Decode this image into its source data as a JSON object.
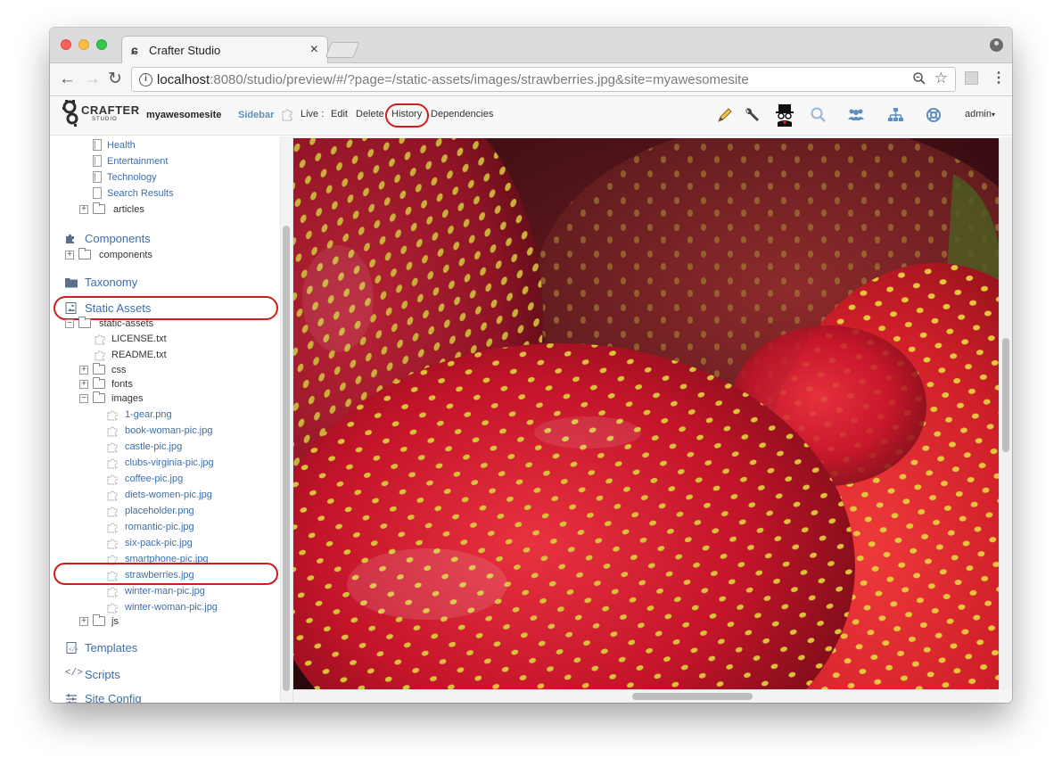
{
  "browser": {
    "tab_title": "Crafter Studio",
    "tab_close": "×",
    "url_host": "localhost",
    "url_rest": ":8080/studio/preview/#/?page=/static-assets/images/strawberries.jpg&site=myawesomesite"
  },
  "header": {
    "logo_text": "CRAFTER",
    "logo_sub": "STUDIO",
    "site_name": "myawesomesite",
    "sidebar_label": "Sidebar",
    "live_label": "Live :",
    "actions": [
      "Edit",
      "Delete",
      "History",
      "Dependencies"
    ],
    "user": "admin",
    "icons": [
      "pencil-icon",
      "wrench-icon",
      "incognito-preview-icon",
      "search-icon",
      "users-icon",
      "sitemap-icon",
      "help-icon"
    ]
  },
  "sidebar": {
    "pages": [
      "Health",
      "Entertainment",
      "Technology",
      "Search Results"
    ],
    "articles_folder": "articles",
    "components_section": "Components",
    "components_folder": "components",
    "taxonomy_section": "Taxonomy",
    "static_assets_section": "Static Assets",
    "static_assets_root": "static-assets",
    "root_files": [
      "LICENSE.txt",
      "README.txt"
    ],
    "root_folders": [
      "css",
      "fonts",
      "images"
    ],
    "images": [
      "1-gear.png",
      "book-woman-pic.jpg",
      "castle-pic.jpg",
      "clubs-virginia-pic.jpg",
      "coffee-pic.jpg",
      "diets-women-pic.jpg",
      "placeholder.png",
      "romantic-pic.jpg",
      "six-pack-pic.jpg",
      "smartphone-pic.jpg",
      "strawberries.jpg",
      "winter-man-pic.jpg",
      "winter-woman-pic.jpg"
    ],
    "js_folder": "js",
    "templates_section": "Templates",
    "scripts_section": "Scripts",
    "site_config_section": "Site Config"
  },
  "colors": {
    "highlight": "#d11c1c",
    "link": "#3d6ea8",
    "strawberry": "#c8142a"
  }
}
